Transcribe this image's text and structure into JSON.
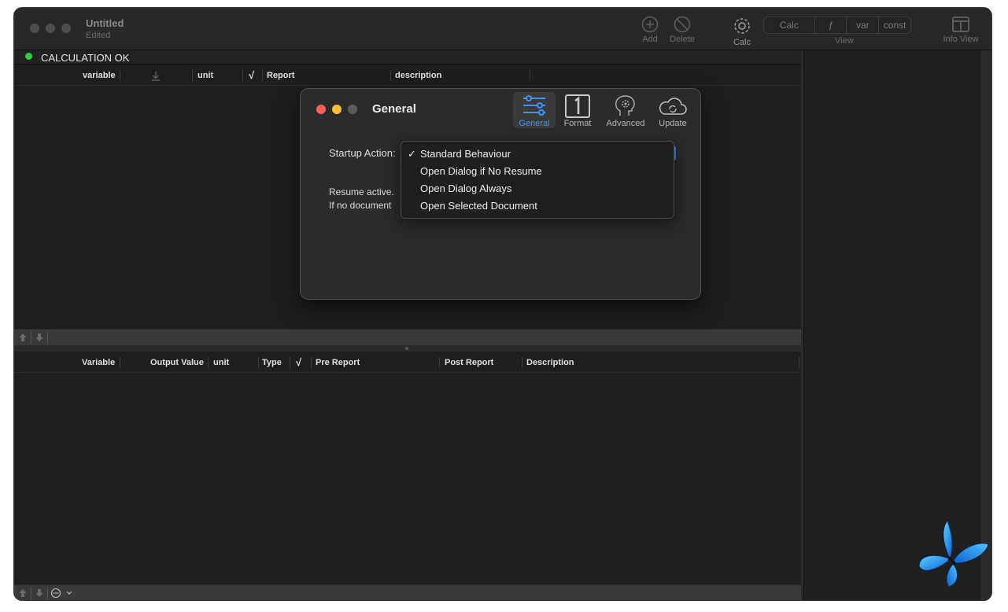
{
  "window": {
    "title": "Untitled",
    "subtitle": "Edited"
  },
  "toolbar": {
    "add_label": "Add",
    "delete_label": "Delete",
    "calc_label": "Calc",
    "view_segments": [
      "Calc",
      "ƒ",
      "var",
      "const"
    ],
    "view_label": "View",
    "info_view_label": "Info View"
  },
  "status": {
    "text": "CALCULATION OK",
    "color": "#2fcf3c"
  },
  "input_table": {
    "columns": [
      "variable",
      "unit",
      "√",
      "Report",
      "description"
    ]
  },
  "output_table": {
    "columns": [
      "Variable",
      "Output Value",
      "unit",
      "Type",
      "√",
      "Pre Report",
      "Post Report",
      "Description"
    ]
  },
  "preferences": {
    "title": "General",
    "tabs": [
      {
        "label": "General",
        "icon": "sliders-icon",
        "active": true
      },
      {
        "label": "Format",
        "icon": "number-one-icon",
        "active": false
      },
      {
        "label": "Advanced",
        "icon": "brain-gear-icon",
        "active": false
      },
      {
        "label": "Update",
        "icon": "cloud-sync-icon",
        "active": false
      }
    ],
    "startup_label": "Startup Action:",
    "resume_line1": "Resume active.",
    "resume_line2": "If no document",
    "menu": {
      "checkmark": "✓",
      "items": [
        {
          "label": "Standard Behaviour",
          "checked": true
        },
        {
          "label": "Open Dialog if No Resume",
          "checked": false
        },
        {
          "label": "Open Dialog Always",
          "checked": false
        },
        {
          "label": "Open Selected Document",
          "checked": false
        }
      ]
    }
  },
  "colors": {
    "accent": "#3a96f4",
    "close": "#ff5f57",
    "minimize": "#febc2e",
    "inactive": "#4d4d4d"
  }
}
